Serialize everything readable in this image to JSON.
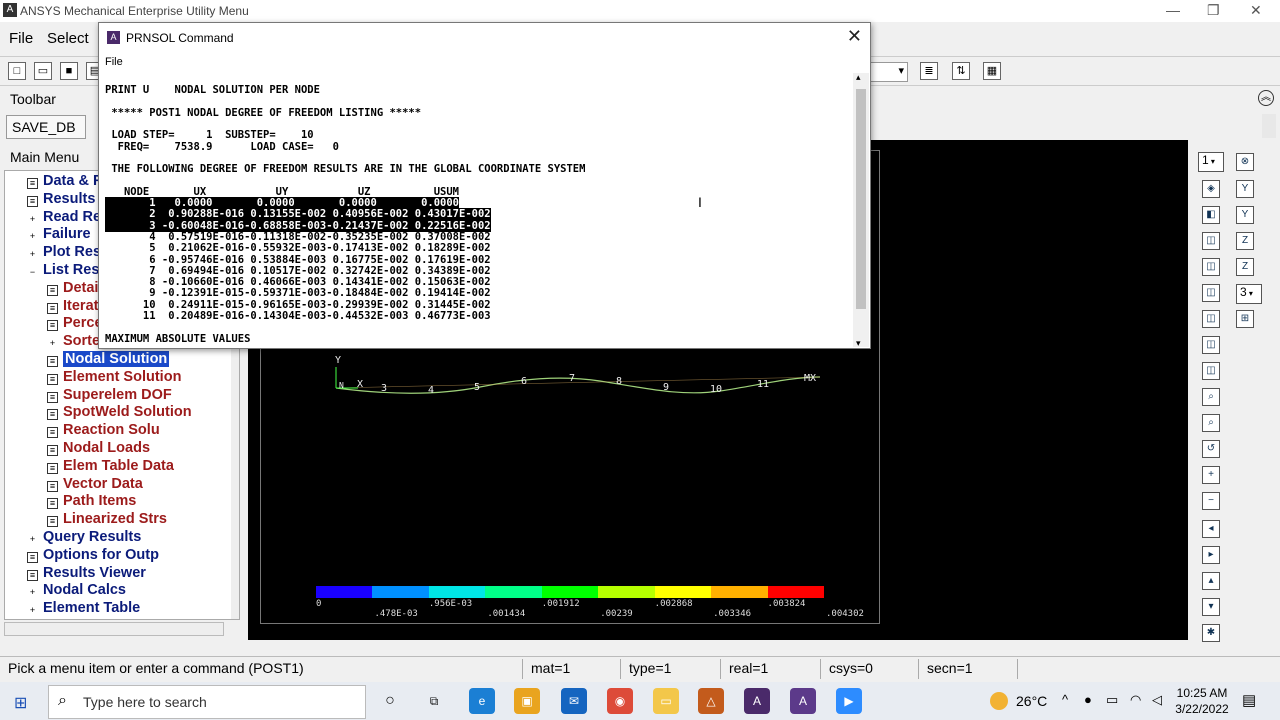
{
  "window": {
    "title": "ANSYS Mechanical Enterprise Utility Menu"
  },
  "menubar": {
    "file": "File",
    "select": "Select"
  },
  "toolbar_label": "Toolbar",
  "save_db": "SAVE_DB",
  "main_menu_label": "Main Menu",
  "tree": [
    {
      "label": "Data & F",
      "indent": 0,
      "kind": "blue"
    },
    {
      "label": "Results",
      "indent": 0,
      "kind": "blue"
    },
    {
      "label": "Read Re",
      "indent": 0,
      "kind": "plus"
    },
    {
      "label": "Failure",
      "indent": 0,
      "kind": "plus"
    },
    {
      "label": "Plot Res",
      "indent": 0,
      "kind": "plus"
    },
    {
      "label": "List Res",
      "indent": 0,
      "kind": "minus"
    },
    {
      "label": "Detai",
      "indent": 1,
      "kind": "red"
    },
    {
      "label": "Iterat",
      "indent": 1,
      "kind": "red"
    },
    {
      "label": "Perce",
      "indent": 1,
      "kind": "red"
    },
    {
      "label": "Sorte",
      "indent": 1,
      "kind": "plusred"
    },
    {
      "label": "Nodal Solution",
      "indent": 1,
      "kind": "sel"
    },
    {
      "label": "Element Solution",
      "indent": 1,
      "kind": "red"
    },
    {
      "label": "Superelem DOF",
      "indent": 1,
      "kind": "red"
    },
    {
      "label": "SpotWeld Solution",
      "indent": 1,
      "kind": "red"
    },
    {
      "label": "Reaction Solu",
      "indent": 1,
      "kind": "red"
    },
    {
      "label": "Nodal Loads",
      "indent": 1,
      "kind": "red"
    },
    {
      "label": "Elem Table Data",
      "indent": 1,
      "kind": "red"
    },
    {
      "label": "Vector Data",
      "indent": 1,
      "kind": "red"
    },
    {
      "label": "Path Items",
      "indent": 1,
      "kind": "red"
    },
    {
      "label": "Linearized Strs",
      "indent": 1,
      "kind": "red"
    },
    {
      "label": "Query Results",
      "indent": 0,
      "kind": "plus"
    },
    {
      "label": "Options for Outp",
      "indent": 0,
      "kind": "blue"
    },
    {
      "label": "Results Viewer",
      "indent": 0,
      "kind": "blue"
    },
    {
      "label": "Nodal Calcs",
      "indent": 0,
      "kind": "plus"
    },
    {
      "label": "Element Table",
      "indent": 0,
      "kind": "plus"
    }
  ],
  "dialog": {
    "title": "PRNSOL  Command",
    "menu_file": "File",
    "lines": [
      "PRINT U    NODAL SOLUTION PER NODE",
      "",
      " ***** POST1 NODAL DEGREE OF FREEDOM LISTING *****",
      "",
      " LOAD STEP=     1  SUBSTEP=    10",
      "  FREQ=    7538.9      LOAD CASE=   0",
      "",
      " THE FOLLOWING DEGREE OF FREEDOM RESULTS ARE IN THE GLOBAL COORDINATE SYSTEM",
      "",
      "   NODE       UX           UY           UZ          USUM",
      "       1   0.0000       0.0000       0.0000       0.0000",
      "       2  0.90288E-016 0.13155E-002 0.40956E-002 0.43017E-002",
      "       3 -0.60048E-016-0.68858E-003-0.21437E-002 0.22516E-002",
      "       4  0.57519E-016-0.11318E-002-0.35235E-002 0.37008E-002",
      "       5  0.21062E-016-0.55932E-003-0.17413E-002 0.18289E-002",
      "       6 -0.95746E-016 0.53884E-003 0.16775E-002 0.17619E-002",
      "       7  0.69494E-016 0.10517E-002 0.32742E-002 0.34389E-002",
      "       8 -0.10660E-016 0.46066E-003 0.14341E-002 0.15063E-002",
      "       9 -0.12391E-015-0.59371E-003-0.18484E-002 0.19414E-002",
      "      10  0.24911E-015-0.96165E-003-0.29939E-002 0.31445E-002",
      "      11  0.20489E-016-0.14304E-003-0.44532E-003 0.46773E-003",
      "",
      "MAXIMUM ABSOLUTE VALUES"
    ]
  },
  "plot": {
    "nodes": [
      "3",
      "4",
      "5",
      "6",
      "7",
      "8",
      "9",
      "10",
      "11"
    ],
    "axis_y": "Y",
    "axis_x": "X",
    "mx": "MX",
    "nlabel": "N",
    "colorbar_top": [
      "0",
      ".956E-03",
      ".001912",
      ".002868",
      ".003824"
    ],
    "colorbar_bottom": [
      ".478E-03",
      ".001434",
      ".00239",
      ".003346",
      ".004302"
    ],
    "colors": [
      "#1a00ff",
      "#0090ff",
      "#00e6e6",
      "#00ff88",
      "#00ff00",
      "#b6ff00",
      "#ffff00",
      "#ffb000",
      "#ff0000"
    ]
  },
  "right_toolbar": {
    "view": "1",
    "num": "3"
  },
  "status": {
    "prompt": "Pick a menu item or enter a command (POST1)",
    "mat": "mat=1",
    "type": "type=1",
    "real": "real=1",
    "csys": "csys=0",
    "secn": "secn=1"
  },
  "taskbar": {
    "search": "Type here to search",
    "temp": "26°C",
    "time": "10:25 AM",
    "date": "3/22/2022"
  }
}
